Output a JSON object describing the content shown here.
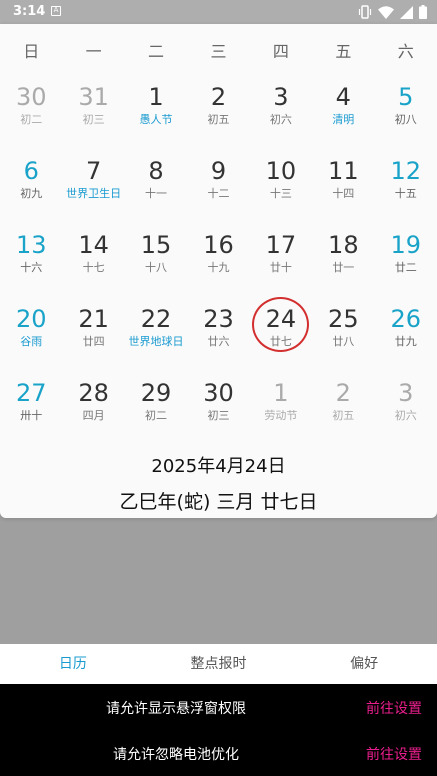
{
  "status_bar": {
    "time": "3:14",
    "notification_letter": "A"
  },
  "weekdays": [
    "日",
    "一",
    "二",
    "三",
    "四",
    "五",
    "六"
  ],
  "calendar": {
    "rows": [
      [
        {
          "day": "30",
          "sub": "初二",
          "kind": "other"
        },
        {
          "day": "31",
          "sub": "初三",
          "kind": "other"
        },
        {
          "day": "1",
          "sub": "愚人节",
          "kind": "normal",
          "festival": true
        },
        {
          "day": "2",
          "sub": "初五",
          "kind": "normal"
        },
        {
          "day": "3",
          "sub": "初六",
          "kind": "normal"
        },
        {
          "day": "4",
          "sub": "清明",
          "kind": "normal",
          "festival": true
        },
        {
          "day": "5",
          "sub": "初八",
          "kind": "weekend"
        }
      ],
      [
        {
          "day": "6",
          "sub": "初九",
          "kind": "weekend"
        },
        {
          "day": "7",
          "sub": "世界卫生日",
          "kind": "normal",
          "festival": true
        },
        {
          "day": "8",
          "sub": "十一",
          "kind": "normal"
        },
        {
          "day": "9",
          "sub": "十二",
          "kind": "normal"
        },
        {
          "day": "10",
          "sub": "十三",
          "kind": "normal"
        },
        {
          "day": "11",
          "sub": "十四",
          "kind": "normal"
        },
        {
          "day": "12",
          "sub": "十五",
          "kind": "weekend"
        }
      ],
      [
        {
          "day": "13",
          "sub": "十六",
          "kind": "weekend"
        },
        {
          "day": "14",
          "sub": "十七",
          "kind": "normal"
        },
        {
          "day": "15",
          "sub": "十八",
          "kind": "normal"
        },
        {
          "day": "16",
          "sub": "十九",
          "kind": "normal"
        },
        {
          "day": "17",
          "sub": "廿十",
          "kind": "normal"
        },
        {
          "day": "18",
          "sub": "廿一",
          "kind": "normal"
        },
        {
          "day": "19",
          "sub": "廿二",
          "kind": "weekend"
        }
      ],
      [
        {
          "day": "20",
          "sub": "谷雨",
          "kind": "weekend",
          "festival": true
        },
        {
          "day": "21",
          "sub": "廿四",
          "kind": "normal"
        },
        {
          "day": "22",
          "sub": "世界地球日",
          "kind": "normal",
          "festival": true
        },
        {
          "day": "23",
          "sub": "廿六",
          "kind": "normal"
        },
        {
          "day": "24",
          "sub": "廿七",
          "kind": "normal",
          "today": true
        },
        {
          "day": "25",
          "sub": "廿八",
          "kind": "normal"
        },
        {
          "day": "26",
          "sub": "廿九",
          "kind": "weekend"
        }
      ],
      [
        {
          "day": "27",
          "sub": "卅十",
          "kind": "weekend"
        },
        {
          "day": "28",
          "sub": "四月",
          "kind": "normal"
        },
        {
          "day": "29",
          "sub": "初二",
          "kind": "normal"
        },
        {
          "day": "30",
          "sub": "初三",
          "kind": "normal"
        },
        {
          "day": "1",
          "sub": "劳动节",
          "kind": "other"
        },
        {
          "day": "2",
          "sub": "初五",
          "kind": "other"
        },
        {
          "day": "3",
          "sub": "初六",
          "kind": "other"
        }
      ]
    ],
    "selected_date": "2025年4月24日",
    "lunar_date": "乙巳年(蛇) 三月 廿七日"
  },
  "tabs": [
    {
      "label": "日历",
      "active": true
    },
    {
      "label": "整点报时",
      "active": false
    },
    {
      "label": "偏好",
      "active": false
    }
  ],
  "notices": [
    {
      "text": "请允许显示悬浮窗权限",
      "action": "前往设置"
    },
    {
      "text": "请允许忽略电池优化",
      "action": "前往设置"
    }
  ],
  "colors": {
    "accent": "#1aa3c9",
    "today_ring": "#d32f2f",
    "notice_action": "#e91e8c"
  },
  "icons": [
    "vibrate-icon",
    "wifi-icon",
    "signal-icon",
    "battery-icon"
  ]
}
